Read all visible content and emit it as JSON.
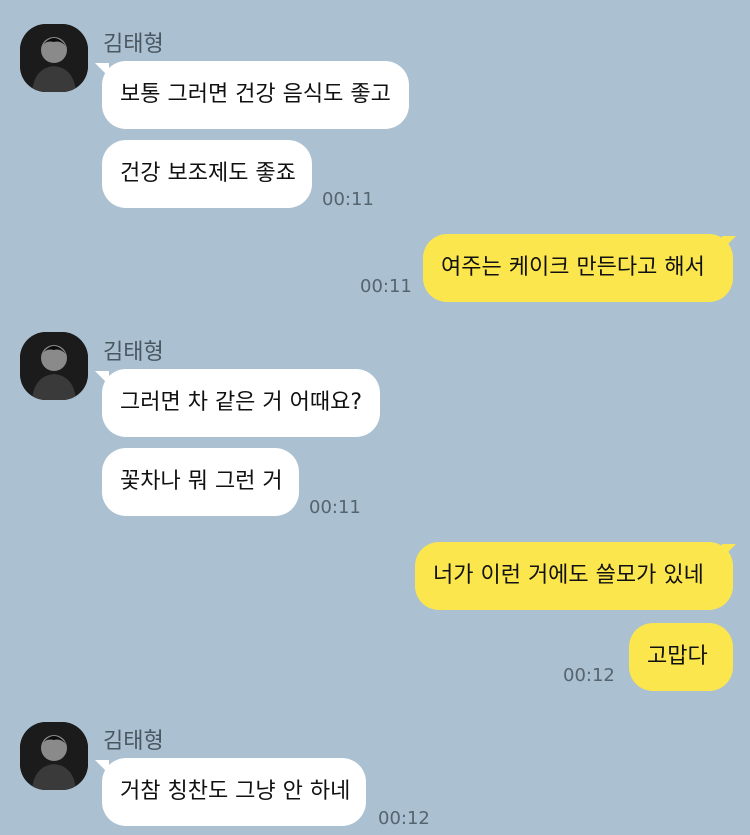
{
  "colors": {
    "background": "#abc1d1",
    "incoming_bubble": "#ffffff",
    "outgoing_bubble": "#fbe64d",
    "timestamp": "#56646e"
  },
  "groups": [
    {
      "sender": "김태형",
      "avatar_icon": "profile-photo-icon",
      "messages": [
        "보통 그러면 건강 음식도 좋고",
        "건강 보조제도 좋죠"
      ],
      "time": "00:11"
    },
    {
      "outgoing": true,
      "messages": [
        "여주는 케이크 만든다고 해서"
      ],
      "time": "00:11"
    },
    {
      "sender": "김태형",
      "avatar_icon": "profile-photo-icon",
      "messages": [
        "그러면 차 같은 거 어때요?",
        "꽃차나 뭐 그런 거"
      ],
      "time": "00:11"
    },
    {
      "outgoing": true,
      "messages": [
        "너가 이런 거에도 쓸모가 있네",
        "고맙다"
      ],
      "time": "00:12"
    },
    {
      "sender": "김태형",
      "avatar_icon": "profile-photo-icon",
      "messages": [
        "거참 칭찬도 그냥 안 하네"
      ],
      "time": "00:12"
    }
  ]
}
